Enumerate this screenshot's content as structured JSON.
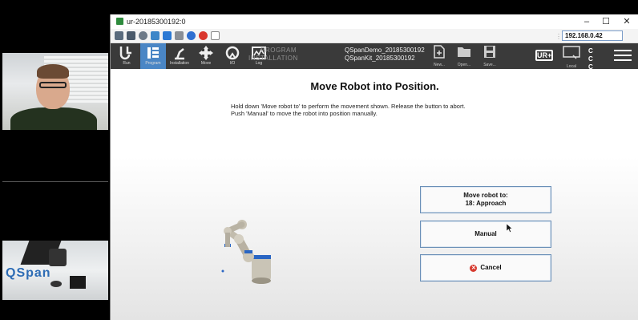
{
  "window": {
    "title": "ur-20185300192:0",
    "minimize": "–",
    "maximize": "☐",
    "close": "✕",
    "address": "192.168.0.42"
  },
  "toolbar_icons": [
    "settings-icon",
    "fullscreen-icon",
    "gear-icon",
    "refresh-icon",
    "windows-icon",
    "keyboard-icon",
    "info-icon",
    "disconnect-icon",
    "file-transfer-icon"
  ],
  "nav": {
    "items": [
      {
        "label": "Run",
        "icon": "ur-logo-icon",
        "active": false
      },
      {
        "label": "Program",
        "icon": "program-icon",
        "active": true
      },
      {
        "label": "Installation",
        "icon": "installation-icon",
        "active": false
      },
      {
        "label": "Move",
        "icon": "move-icon",
        "active": false
      },
      {
        "label": "I/O",
        "icon": "io-icon",
        "active": false
      },
      {
        "label": "Log",
        "icon": "log-icon",
        "active": false
      }
    ]
  },
  "program_info": {
    "program_key": "PROGRAM",
    "program_value": "QSpanDemo_20185300192",
    "installation_key": "INSTALLATION",
    "installation_value": "QSpanKit_20185300192"
  },
  "file_buttons": [
    {
      "label": "New...",
      "icon": "new-file-icon"
    },
    {
      "label": "Open...",
      "icon": "open-folder-icon"
    },
    {
      "label": "Save...",
      "icon": "save-icon"
    }
  ],
  "header_right": {
    "urplus": "UR+",
    "local_label": "Local",
    "cc_top": "C C",
    "cc_bottom": "C C"
  },
  "dialog": {
    "heading": "Move Robot into Position.",
    "instruction_line1": "Hold down 'Move robot to' to perform the movement shown. Release the button to abort.",
    "instruction_line2": "Push 'Manual' to move the robot into position manually.",
    "move_button_line1": "Move robot to:",
    "move_button_line2": "18: Approach",
    "manual_button": "Manual",
    "cancel_button": "Cancel"
  },
  "colors": {
    "header_bg": "#3a3a3a",
    "active_tab": "#4a86c5",
    "button_border": "#6a8fb7",
    "cancel_red": "#d63a2f"
  }
}
